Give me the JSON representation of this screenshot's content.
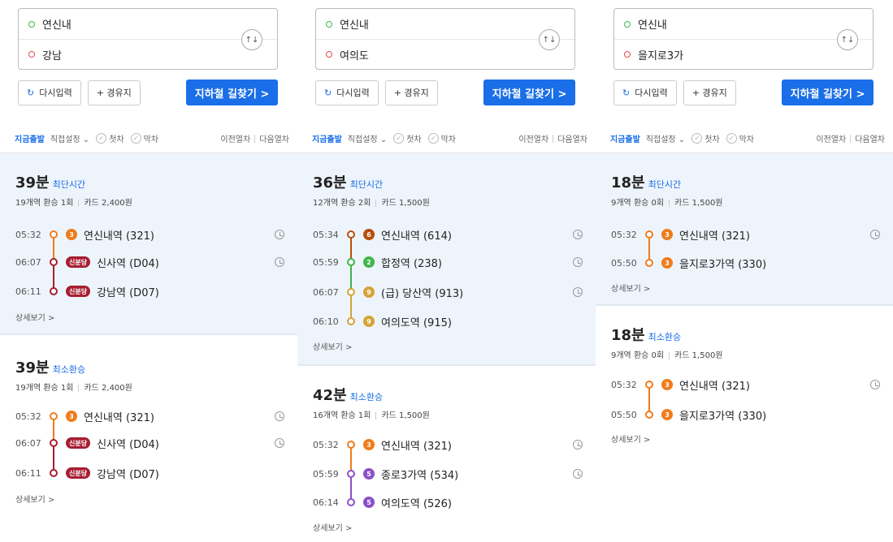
{
  "common": {
    "reset_label": "다시입력",
    "via_label": "+ 경유지",
    "search_label": "지하철 길찾기 >",
    "depart_now": "지금출발",
    "direct_set": "직접설정",
    "first_train": "첫차",
    "last_train": "막차",
    "prev_train": "이전열차",
    "next_train": "다음열차",
    "detail_label": "상세보기 >",
    "colors": {
      "accent": "#1a6ee8",
      "line3": "#ef7c1c",
      "line6": "#b5500b",
      "line2": "#3fb54a",
      "line4": "#00a5de",
      "line5": "#8b50c8",
      "line9": "#d4a437",
      "sinbundang": "#a71e31"
    }
  },
  "columns": [
    {
      "origin": "연신내",
      "destination": "강남",
      "routes": [
        {
          "time": "39분",
          "tag": "최단시간",
          "stations": "19개역 환승 1회",
          "fare": "카드 2,400원",
          "stops": [
            {
              "time": "05:32",
              "badge": "3",
              "station": "연신내역 (321)",
              "color": "#ef7c1c"
            },
            {
              "time": "06:07",
              "badge": "신분당",
              "station": "신사역 (D04)",
              "color": "#a71e31"
            },
            {
              "time": "06:11",
              "badge": "신분당",
              "station": "강남역 (D07)",
              "color": "#a71e31"
            }
          ]
        },
        {
          "time": "39분",
          "tag": "최소환승",
          "stations": "19개역 환승 1회",
          "fare": "카드 2,400원",
          "stops": [
            {
              "time": "05:32",
              "badge": "3",
              "station": "연신내역 (321)",
              "color": "#ef7c1c"
            },
            {
              "time": "06:07",
              "badge": "신분당",
              "station": "신사역 (D04)",
              "color": "#a71e31"
            },
            {
              "time": "06:11",
              "badge": "신분당",
              "station": "강남역 (D07)",
              "color": "#a71e31"
            }
          ]
        }
      ]
    },
    {
      "origin": "연신내",
      "destination": "여의도",
      "routes": [
        {
          "time": "36분",
          "tag": "최단시간",
          "stations": "12개역 환승 2회",
          "fare": "카드 1,500원",
          "stops": [
            {
              "time": "05:34",
              "badge": "6",
              "station": "연신내역 (614)",
              "color": "#b5500b"
            },
            {
              "time": "05:59",
              "badge": "2",
              "station": "합정역 (238)",
              "color": "#3fb54a"
            },
            {
              "time": "06:07",
              "badge": "9",
              "station": "(급) 당산역 (913)",
              "color": "#d4a437"
            },
            {
              "time": "06:10",
              "badge": "9",
              "station": "여의도역 (915)",
              "color": "#d4a437"
            }
          ]
        },
        {
          "time": "42분",
          "tag": "최소환승",
          "stations": "16개역 환승 1회",
          "fare": "카드 1,500원",
          "stops": [
            {
              "time": "05:32",
              "badge": "3",
              "station": "연신내역 (321)",
              "color": "#ef7c1c"
            },
            {
              "time": "05:59",
              "badge": "5",
              "station": "종로3가역 (534)",
              "color": "#8b50c8"
            },
            {
              "time": "06:14",
              "badge": "5",
              "station": "여의도역 (526)",
              "color": "#8b50c8"
            }
          ]
        }
      ]
    },
    {
      "origin": "연신내",
      "destination": "을지로3가",
      "routes": [
        {
          "time": "18분",
          "tag": "최단시간",
          "stations": "9개역 환승 0회",
          "fare": "카드 1,500원",
          "stops": [
            {
              "time": "05:32",
              "badge": "3",
              "station": "연신내역 (321)",
              "color": "#ef7c1c"
            },
            {
              "time": "05:50",
              "badge": "3",
              "station": "을지로3가역 (330)",
              "color": "#ef7c1c"
            }
          ]
        },
        {
          "time": "18분",
          "tag": "최소환승",
          "stations": "9개역 환승 0회",
          "fare": "카드 1,500원",
          "stops": [
            {
              "time": "05:32",
              "badge": "3",
              "station": "연신내역 (321)",
              "color": "#ef7c1c"
            },
            {
              "time": "05:50",
              "badge": "3",
              "station": "을지로3가역 (330)",
              "color": "#ef7c1c"
            }
          ]
        }
      ]
    }
  ]
}
